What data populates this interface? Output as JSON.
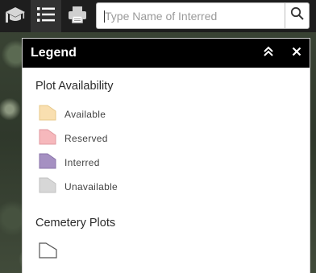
{
  "toolbar": {
    "search_placeholder": "Type Name of Interred"
  },
  "legend": {
    "title": "Legend",
    "sections": [
      {
        "title": "Plot Availability",
        "items": [
          {
            "label": "Available",
            "color": "#f9dfb0",
            "stroke": "#e8c98a"
          },
          {
            "label": "Reserved",
            "color": "#f6b8bc",
            "stroke": "#e09aa0"
          },
          {
            "label": "Interred",
            "color": "#a590c2",
            "stroke": "#8a74aa"
          },
          {
            "label": "Unavailable",
            "color": "#d7d7d7",
            "stroke": "#c2c2c2"
          }
        ]
      },
      {
        "title": "Cemetery Plots"
      }
    ]
  },
  "colors": {
    "toolbar_bg": "#1e1e1e",
    "active_tool_bg": "#323232",
    "legend_header_bg": "#000000"
  },
  "icons": {
    "toolbar": [
      "graduation-cap-icon",
      "list-icon",
      "printer-icon",
      "search-icon"
    ],
    "legend_header": [
      "double-chevron-up-icon",
      "close-icon"
    ]
  }
}
